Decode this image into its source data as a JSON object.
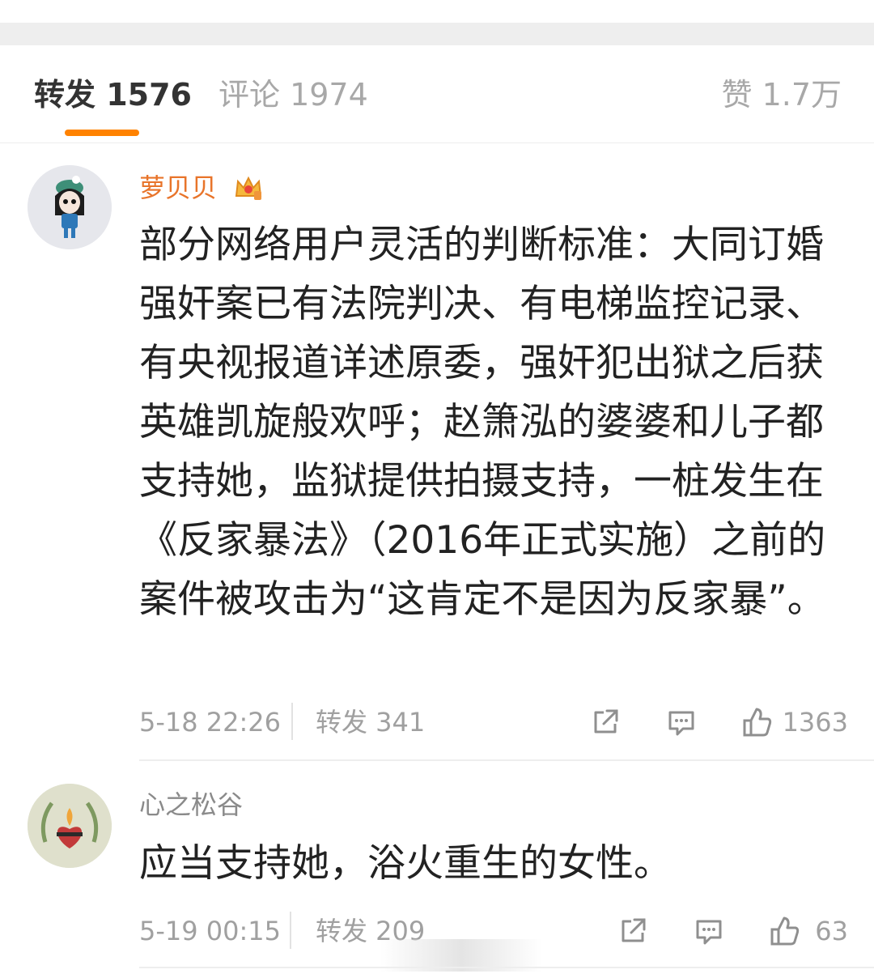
{
  "tabs": {
    "forward": "转发 1576",
    "comments": "评论 1974",
    "likes": "赞 1.7万"
  },
  "comments": [
    {
      "username": "萝贝贝",
      "text": "部分网络用户灵活的判断标准：大同订婚强奸案已有法院判决、有电梯监控记录、有央视报道详述原委，强奸犯出狱之后获英雄凯旋般欢呼；赵箫泓的婆婆和儿子都支持她，监狱提供拍摄支持，一桩发生在《反家暴法》（2016年正式实施）之前的案件被攻击为“这肯定不是因为反家暴”。",
      "time": "5-18 22:26",
      "repost": "转发 341",
      "likes": "1363"
    },
    {
      "username": "心之松谷",
      "text": "应当支持她，浴火重生的女性。",
      "time": "5-19 00:15",
      "repost": "转发 209",
      "likes": "63"
    }
  ],
  "colors": {
    "accent": "#ff8200",
    "vip_name": "#e8742a",
    "muted": "#a0a0a0"
  },
  "icons": [
    "share-icon",
    "comment-icon",
    "like-icon",
    "crown-icon"
  ]
}
